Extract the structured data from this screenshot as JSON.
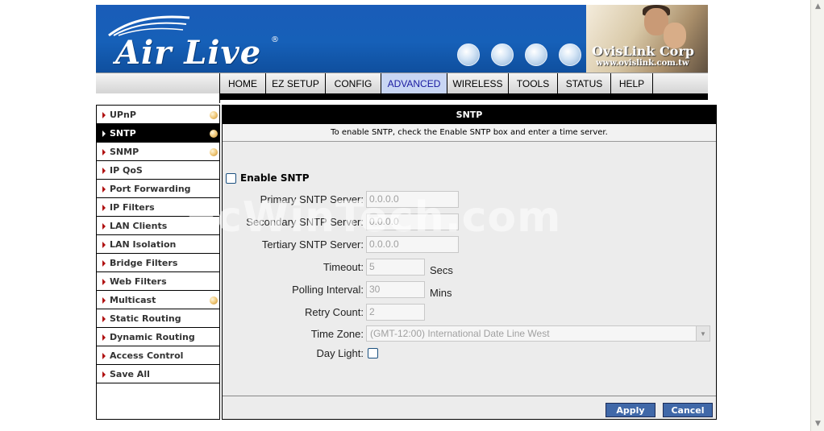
{
  "header": {
    "brand": "Air Live",
    "brand_reg": "®",
    "company": "OvisLink Corp",
    "company_url": "www.ovislink.com.tw",
    "brand_color": "#1660b8"
  },
  "nav": {
    "tabs": [
      {
        "label": "HOME"
      },
      {
        "label": "EZ SETUP"
      },
      {
        "label": "CONFIG"
      },
      {
        "label": "ADVANCED",
        "active": true
      },
      {
        "label": "WIRELESS"
      },
      {
        "label": "TOOLS"
      },
      {
        "label": "STATUS"
      },
      {
        "label": "HELP"
      }
    ]
  },
  "sidebar": {
    "items": [
      {
        "label": "UPnP",
        "dot": true
      },
      {
        "label": "SNTP",
        "dot": true,
        "active": true
      },
      {
        "label": "SNMP",
        "dot": true
      },
      {
        "label": "IP QoS"
      },
      {
        "label": "Port Forwarding"
      },
      {
        "label": "IP Filters"
      },
      {
        "label": "LAN Clients"
      },
      {
        "label": "LAN Isolation"
      },
      {
        "label": "Bridge Filters"
      },
      {
        "label": "Web Filters"
      },
      {
        "label": "Multicast",
        "dot": true
      },
      {
        "label": "Static Routing"
      },
      {
        "label": "Dynamic Routing"
      },
      {
        "label": "Access Control"
      },
      {
        "label": "Save All"
      }
    ]
  },
  "content": {
    "title": "SNTP",
    "description": "To enable SNTP, check the Enable SNTP box and enter a time server.",
    "enable_label": "Enable SNTP",
    "enable_checked": false,
    "fields": {
      "primary": {
        "label": "Primary SNTP Server:",
        "value": "0.0.0.0"
      },
      "secondary": {
        "label": "Secondary SNTP Server:",
        "value": "0.0.0.0"
      },
      "tertiary": {
        "label": "Tertiary SNTP Server:",
        "value": "0.0.0.0"
      },
      "timeout": {
        "label": "Timeout:",
        "value": "5",
        "unit": "Secs"
      },
      "polling": {
        "label": "Polling Interval:",
        "value": "30",
        "unit": "Mins"
      },
      "retry": {
        "label": "Retry Count:",
        "value": "2"
      },
      "timezone": {
        "label": "Time Zone:",
        "value": "(GMT-12:00) International Date Line West"
      },
      "daylight": {
        "label": "Day Light:",
        "checked": false
      }
    },
    "apply_label": "Apply",
    "cancel_label": "Cancel"
  },
  "watermark": "PcWinTech.com"
}
